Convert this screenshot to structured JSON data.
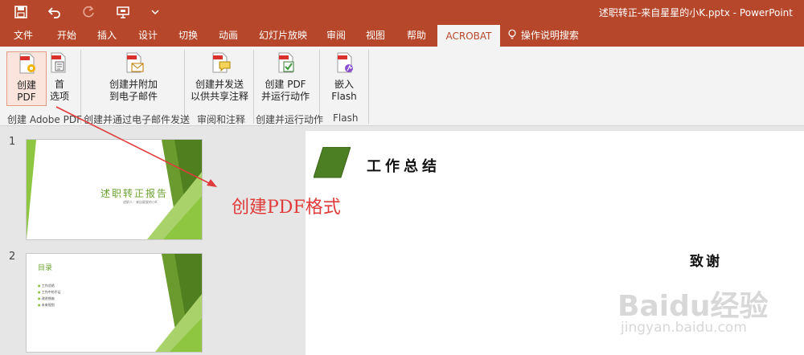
{
  "window": {
    "title": "述职转正-来自星星的小K.pptx  -  PowerPoint",
    "brand_color": "#b7472a"
  },
  "quick_access": {
    "save": "save-icon",
    "undo": "undo-icon",
    "redo": "redo-icon",
    "present": "presenter-icon",
    "customize": "chevron-down-icon"
  },
  "tabs": [
    "文件",
    "开始",
    "插入",
    "设计",
    "切换",
    "动画",
    "幻灯片放映",
    "审阅",
    "视图",
    "帮助",
    "ACROBAT"
  ],
  "active_tab": "ACROBAT",
  "tell_me": "操作说明搜索",
  "ribbon": {
    "create_pdf": [
      "创建",
      "PDF"
    ],
    "preferences": [
      "首",
      "选项"
    ],
    "create_attach": [
      "创建并附加",
      "到电子邮件"
    ],
    "create_send": [
      "创建并发送",
      "以供共享注释"
    ],
    "create_run": [
      "创建 PDF",
      "并运行动作"
    ],
    "embed_flash": [
      "嵌入",
      "Flash"
    ],
    "groups": [
      "创建 Adobe PDF",
      "创建并通过电子邮件发送",
      "审阅和注释",
      "创建并运行动作",
      "Flash"
    ]
  },
  "thumbnails": [
    {
      "number": "1",
      "title": "述职转正报告",
      "subtitle": "述职人：来自星星的小K"
    },
    {
      "number": "2",
      "title": "目录",
      "items": [
        "工作总结",
        "工作中的不足",
        "改进措施",
        "未来规划"
      ]
    }
  ],
  "slide": {
    "heading": "工作总结",
    "thanks": "致谢"
  },
  "annotation": {
    "text": "创建PDF格式",
    "color": "#e03a3a"
  },
  "watermark": {
    "logo": "Baidu经验",
    "url": "jingyan.baidu.com"
  }
}
